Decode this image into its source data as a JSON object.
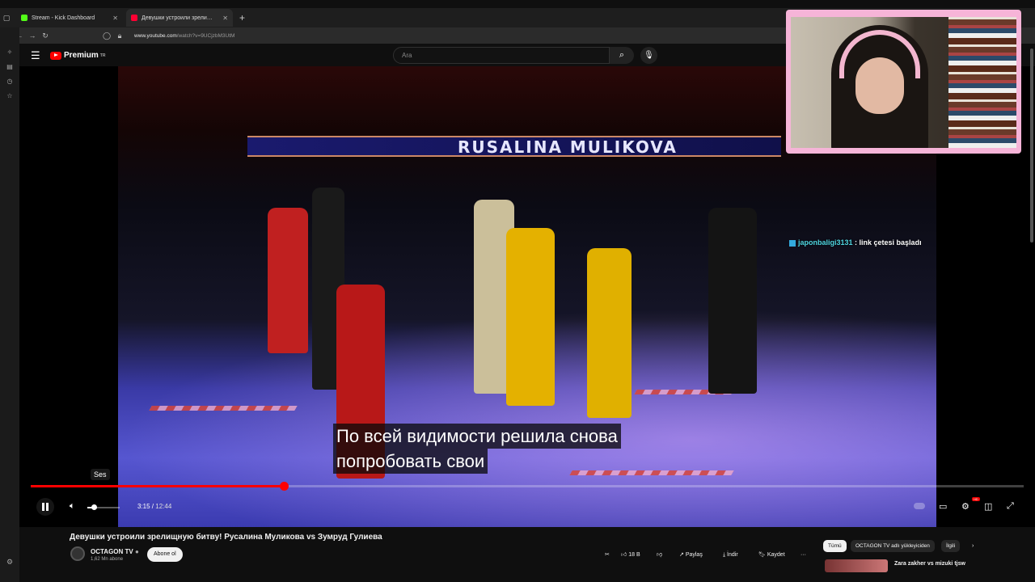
{
  "browser": {
    "tabs": [
      {
        "label": "Stream - Kick Dashboard",
        "favicon_color": "#53fc18"
      },
      {
        "label": "Девушки устроили зрели…",
        "favicon_color": "#ff0033"
      }
    ],
    "url_host": "www.youtube.com",
    "url_path": "/watch?v=9UCjzbM3UtM"
  },
  "header": {
    "logo_text": "Premium",
    "logo_sup": "TR",
    "search_placeholder": "Ara"
  },
  "player": {
    "banner_text": "RUSALINA MULIKOVA",
    "subtitle_line1": "По всей видимости решила снова",
    "subtitle_line2": "попробовать свои",
    "tooltip": "Ses",
    "current_time": "3:15",
    "separator": " / ",
    "duration": "12:44",
    "progress": 0.255,
    "volume": 0.2,
    "hd_badge": "HD"
  },
  "chat_overlay": {
    "user": "japonbaligi3131",
    "message": " : link çetesi başladı"
  },
  "video_info": {
    "title": "Девушки устроили зрелищную битву! Русалина Муликова vs Зумруд Гулиева",
    "channel_name": "OCTAGON TV",
    "subscribers": "1,62 Mn abone",
    "subscribe_label": "Abone ol",
    "like_count": "18 B",
    "share_label": "Paylaş",
    "download_label": "İndir",
    "save_label": "Kaydet",
    "more_label": "···"
  },
  "related": {
    "chips": [
      "Tümü",
      "OCTAGON TV adlı yükleyiciden",
      "İlgili"
    ],
    "first_title": "Zara zakher vs mizuki tjsw"
  }
}
